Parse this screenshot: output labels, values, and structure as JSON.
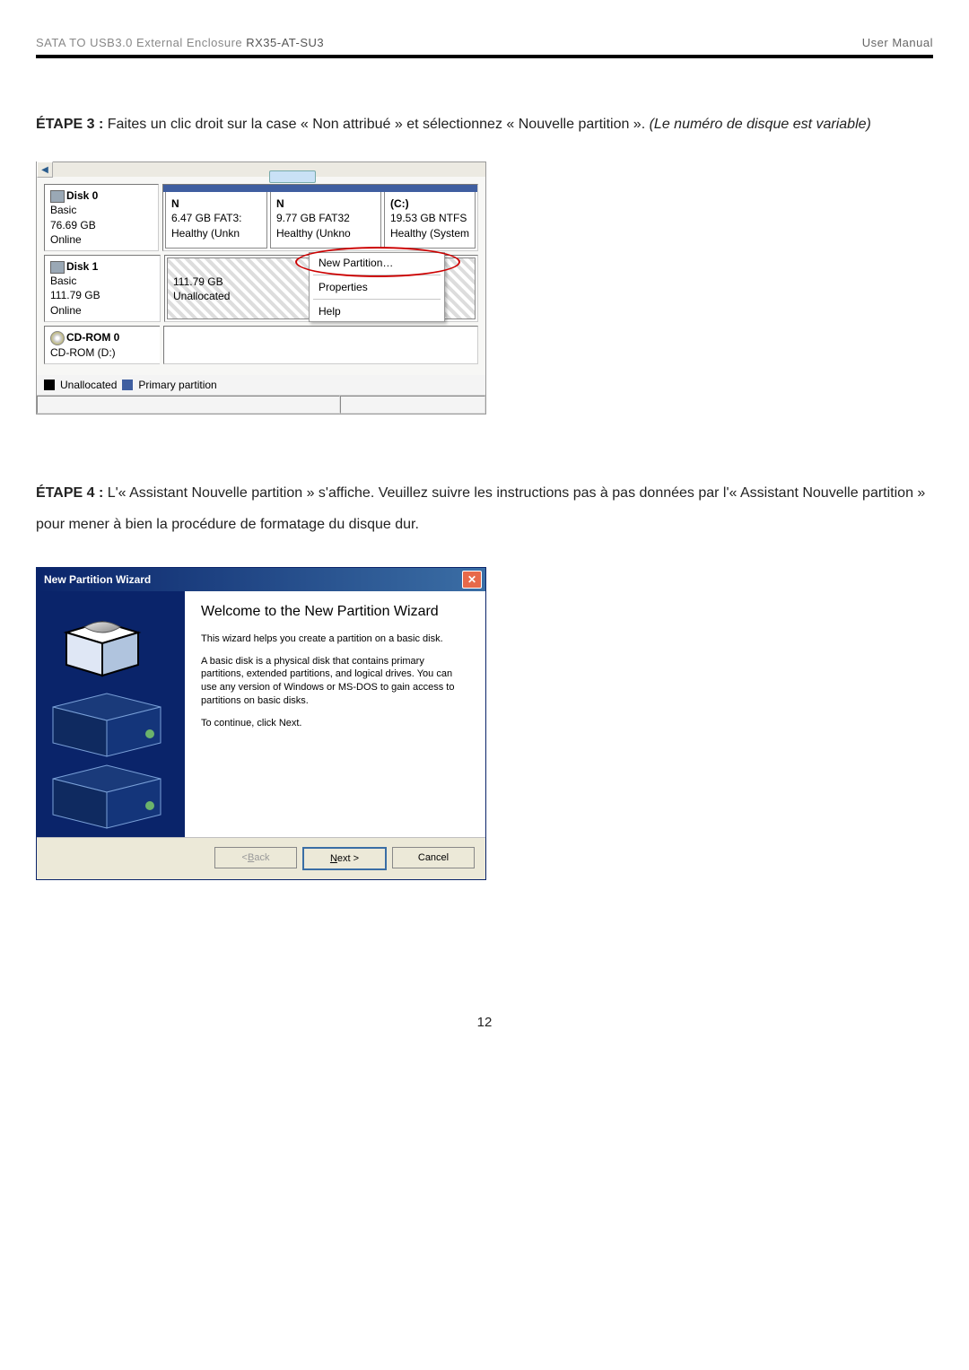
{
  "header": {
    "product_prefix": "SATA TO USB3.0 External Enclosure ",
    "model": "RX35-AT-SU3",
    "right": "User Manual"
  },
  "step3": {
    "label": "ÉTAPE 3 : ",
    "text": "Faites un clic droit sur la case « Non attribué » et sélectionnez « Nouvelle partition ». ",
    "italic": "(Le numéro de disque est variable)"
  },
  "dm": {
    "disk0": {
      "title": "Disk 0",
      "l1": "Basic",
      "l2": "76.69 GB",
      "l3": "Online",
      "parts": [
        {
          "h": "N",
          "l1": "6.47 GB FAT3:",
          "l2": "Healthy (Unkn"
        },
        {
          "h": "N",
          "l1": "9.77 GB FAT32",
          "l2": "Healthy (Unkno"
        },
        {
          "h": "(C:)",
          "l1": "19.53 GB NTFS",
          "l2": "Healthy (System"
        }
      ]
    },
    "disk1": {
      "title": "Disk 1",
      "l1": "Basic",
      "l2": "111.79 GB",
      "l3": "Online",
      "unalloc_l1": "111.79 GB",
      "unalloc_l2": "Unallocated"
    },
    "cdrom": {
      "title": "CD-ROM 0",
      "l1": "CD-ROM (D:)"
    },
    "context_menu": {
      "item1": "New Partition…",
      "item2": "Properties",
      "item3": "Help"
    },
    "legend": {
      "l1": "Unallocated",
      "l2": "Primary partition"
    }
  },
  "step4": {
    "label": "ÉTAPE 4 : ",
    "text": "L'« Assistant Nouvelle partition » s'affiche. Veuillez suivre les instructions pas à pas données par l'« Assistant Nouvelle partition » pour mener à bien la procédure de formatage du disque dur."
  },
  "wizard": {
    "title": "New Partition Wizard",
    "heading": "Welcome to the New Partition Wizard",
    "p1": "This wizard helps you create a partition on a basic disk.",
    "p2": "A basic disk is a physical disk that contains primary partitions, extended partitions, and logical drives. You can use any version of Windows or MS-DOS to gain access to partitions on basic disks.",
    "p3": "To continue, click Next.",
    "buttons": {
      "back_lt": "< ",
      "back_u": "B",
      "back_rest": "ack",
      "next_u": "N",
      "next_rest": "ext >",
      "cancel": "Cancel"
    }
  },
  "page_number": "12"
}
